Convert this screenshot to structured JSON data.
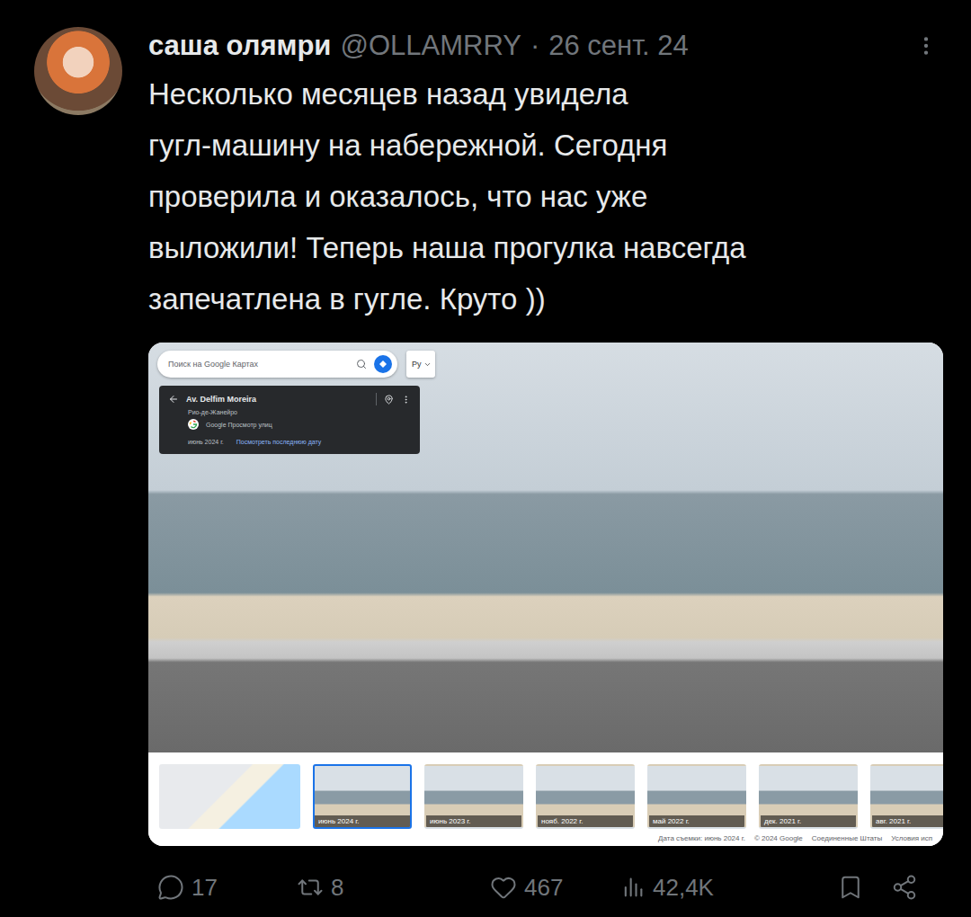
{
  "tweet": {
    "author": {
      "name": "саша олямри",
      "handle": "@OLLAMRRY"
    },
    "separator": "·",
    "date": "26 сент. 24",
    "text_lines": [
      "Несколько месяцев назад увидела",
      "гугл-машину на набережной. Сегодня",
      "проверила и оказалось, что нас уже",
      "выложили! Теперь наша прогулка навсегда",
      "запечатлена в гугле. Круто ))"
    ]
  },
  "embedded_maps": {
    "search": {
      "placeholder": "Поиск на Google Картах"
    },
    "language_button": "Ру",
    "place_panel": {
      "title": "Av. Delfim Moreira",
      "subtitle": "Рио-де-Жанейро",
      "source": "Google Просмотр улиц",
      "capture_date": "июнь 2024 г.",
      "link": "Посмотреть последнюю дату"
    },
    "timeline": [
      {
        "label": "июнь 2024 г.",
        "selected": true
      },
      {
        "label": "июнь 2023 г.",
        "selected": false
      },
      {
        "label": "нояб. 2022 г.",
        "selected": false
      },
      {
        "label": "май 2022 г.",
        "selected": false
      },
      {
        "label": "дек. 2021 г.",
        "selected": false
      },
      {
        "label": "авг. 2021 г.",
        "selected": false
      }
    ],
    "footer": [
      "Дата съемки: июнь 2024 г.",
      "© 2024 Google",
      "Соединенные Штаты",
      "Условия исп"
    ]
  },
  "actions": [
    {
      "kind": "reply",
      "count": "17"
    },
    {
      "kind": "repost",
      "count": "8"
    },
    {
      "kind": "like",
      "count": "467"
    },
    {
      "kind": "views",
      "count": "42,4K"
    },
    {
      "kind": "bookmark"
    },
    {
      "kind": "share"
    }
  ]
}
